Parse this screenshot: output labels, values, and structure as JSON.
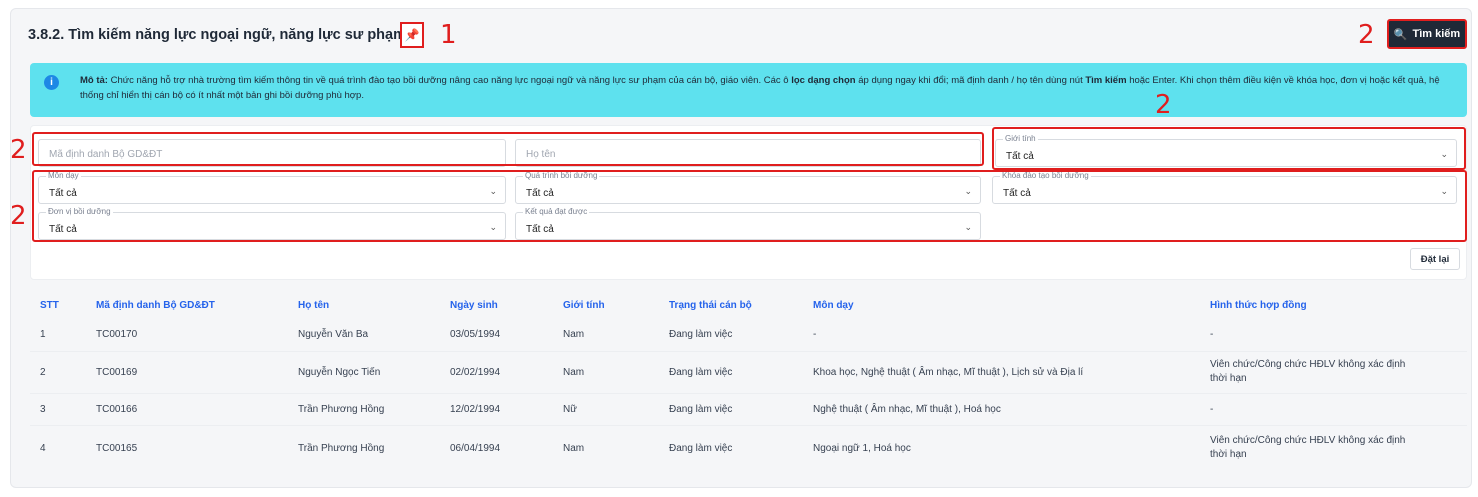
{
  "page": {
    "title": "3.8.2. Tìm kiếm năng lực ngoại ngữ, năng lực sư phạm",
    "search_button": "Tìm kiếm",
    "reset_button": "Đặt lại"
  },
  "annotations": {
    "mark1": "1",
    "mark2": "2"
  },
  "info": {
    "label": "Mô tả:",
    "text1": "Chức năng hỗ trợ nhà trường tìm kiếm thông tin về quá trình đào tạo bồi dưỡng nâng cao năng lực ngoại ngữ và năng lực sư phạm của cán bộ, giáo viên. Các ô",
    "bold1": "lọc dạng chọn",
    "text2": "áp dụng ngay khi đổi; mã định danh / họ tên dùng nút",
    "bold2": "Tìm kiếm",
    "text3": "hoặc Enter. Khi chọn thêm điều kiện về khóa học, đơn vị hoặc kết quả, hệ thống chỉ hiển thị cán bộ có ít nhất một bản ghi bồi dưỡng phù hợp."
  },
  "filters": {
    "ma_dinh_danh_placeholder": "Mã định danh Bộ GD&ĐT",
    "ho_ten_placeholder": "Họ tên",
    "gioi_tinh": {
      "label": "Giới tính",
      "value": "Tất cả"
    },
    "mon_day": {
      "label": "Môn dạy",
      "value": "Tất cả"
    },
    "qua_trinh": {
      "label": "Quá trình bồi dưỡng",
      "value": "Tất cả"
    },
    "khoa_dao_tao": {
      "label": "Khóa đào tạo bồi dưỡng",
      "value": "Tất cả"
    },
    "don_vi": {
      "label": "Đơn vị bồi dưỡng",
      "value": "Tất cả"
    },
    "ket_qua": {
      "label": "Kết quả đạt được",
      "value": "Tất cả"
    }
  },
  "table": {
    "headers": [
      "STT",
      "Mã định danh Bộ GD&ĐT",
      "Họ tên",
      "Ngày sinh",
      "Giới tính",
      "Trạng thái cán bộ",
      "Môn dạy",
      "Hình thức hợp đồng"
    ],
    "rows": [
      [
        "1",
        "TC00170",
        "Nguyễn Văn Ba",
        "03/05/1994",
        "Nam",
        "Đang làm việc",
        "-",
        "-"
      ],
      [
        "2",
        "TC00169",
        "Nguyễn Ngọc Tiến",
        "02/02/1994",
        "Nam",
        "Đang làm việc",
        "Khoa học, Nghệ thuật ( Âm nhạc, Mĩ thuật ), Lịch sử và Địa lí",
        "Viên chức/Công chức HĐLV không xác định thời hạn"
      ],
      [
        "3",
        "TC00166",
        "Trần Phương Hồng",
        "12/02/1994",
        "Nữ",
        "Đang làm việc",
        "Nghệ thuật ( Âm nhạc, Mĩ thuật ), Hoá học",
        "-"
      ],
      [
        "4",
        "TC00165",
        "Trần Phương Hồng",
        "06/04/1994",
        "Nam",
        "Đang làm việc",
        "Ngoại ngữ 1, Hoá học",
        "Viên chức/Công chức HĐLV không xác định thời hạn"
      ]
    ]
  },
  "colors": {
    "accent": "#2563eb",
    "annotation_red": "#e01e1e",
    "info_bg": "#5ee1ee",
    "button_dark": "#1f2937"
  },
  "icons": [
    "pin-icon",
    "search-icon",
    "info-icon",
    "chevron-down-icon"
  ]
}
